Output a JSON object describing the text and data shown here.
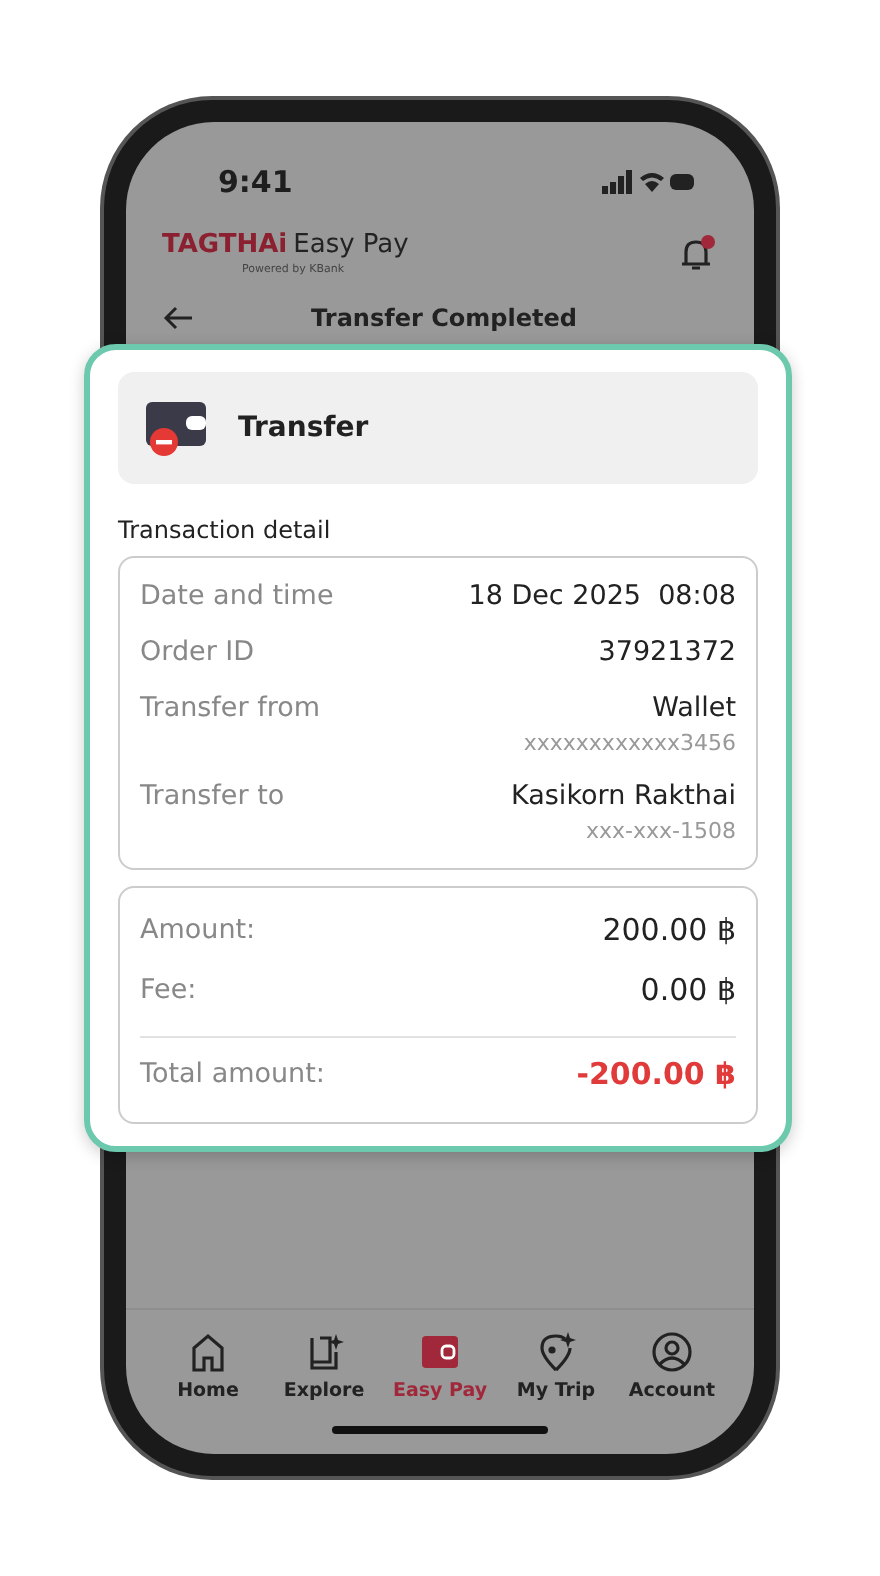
{
  "status_bar": {
    "time": "9:41"
  },
  "header": {
    "brand": "TAGTHAi",
    "product": "Easy Pay",
    "powered_by": "Powered by KBank"
  },
  "page": {
    "title": "Transfer Completed"
  },
  "card": {
    "title": "Transfer",
    "section_label": "Transaction detail",
    "details": [
      {
        "label": "Date and time",
        "value": "18 Dec 2025  08:08"
      },
      {
        "label": "Order ID",
        "value": "37921372"
      },
      {
        "label": "Transfer from",
        "value": "Wallet",
        "sub": "xxxxxxxxxxxx3456"
      },
      {
        "label": "Transfer to",
        "value": "Kasikorn Rakthai",
        "sub": "xxx-xxx-1508"
      }
    ],
    "amounts": [
      {
        "label": "Amount:",
        "value": "200.00 ฿",
        "kind": "line"
      },
      {
        "label": "Fee:",
        "value": "0.00 ฿",
        "kind": "line"
      },
      {
        "label": "Total amount:",
        "value": "-200.00 ฿",
        "kind": "total"
      }
    ]
  },
  "tabs": [
    {
      "label": "Home",
      "kind": "home",
      "selected": false
    },
    {
      "label": "Explore",
      "kind": "explore",
      "selected": false
    },
    {
      "label": "Easy Pay",
      "kind": "wallet",
      "selected": true
    },
    {
      "label": "My Trip",
      "kind": "pin",
      "selected": false
    },
    {
      "label": "Account",
      "kind": "account",
      "selected": false
    }
  ]
}
